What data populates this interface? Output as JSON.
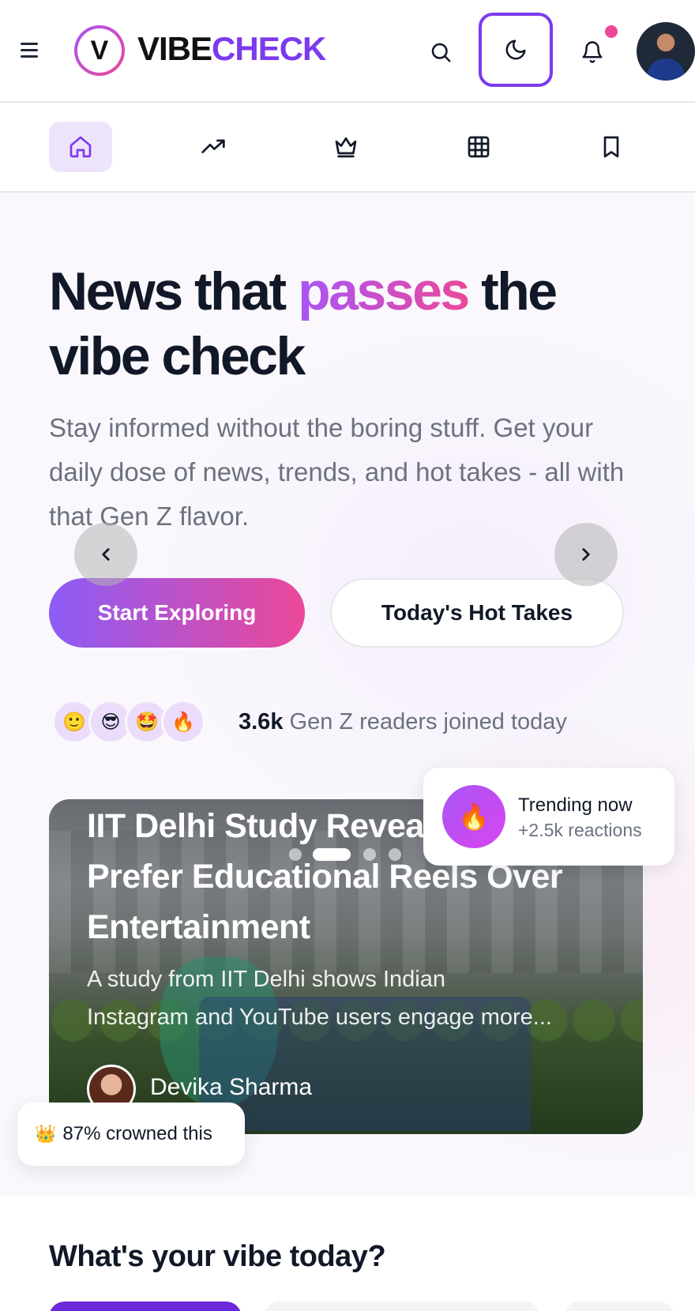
{
  "header": {
    "logo_letter": "V",
    "logo_text_a": "VIBE",
    "logo_text_b": "CHECK"
  },
  "nav": {
    "tabs": [
      {
        "name": "home",
        "icon": "home-icon",
        "active": true
      },
      {
        "name": "trending",
        "icon": "trending-icon",
        "active": false
      },
      {
        "name": "crowned",
        "icon": "crown-icon",
        "active": false
      },
      {
        "name": "categories",
        "icon": "grid-icon",
        "active": false
      },
      {
        "name": "saved",
        "icon": "bookmark-icon",
        "active": false
      }
    ]
  },
  "hero": {
    "title_part1": "News that ",
    "title_highlight": "passes",
    "title_part2": " the vibe check",
    "subtitle": "Stay informed without the boring stuff. Get your daily dose of news, trends, and hot takes - all with that Gen Z flavor.",
    "primary_button": "Start Exploring",
    "secondary_button": "Today's Hot Takes",
    "reader_emojis": [
      "🙂",
      "😎",
      "🤩",
      "🔥"
    ],
    "reader_count": "3.6k",
    "reader_text": " Gen Z readers joined today"
  },
  "carousel": {
    "title": "IIT Delhi Study Reveals Users Prefer Educational Reels Over Entertainment",
    "description_line1": "A study from IIT Delhi shows Indian",
    "description_line2": "Instagram and YouTube users engage more...",
    "author": "Devika Sharma",
    "slide_count": 4,
    "active_slide": 2
  },
  "trending_card": {
    "emoji": "🔥",
    "title": "Trending now",
    "subtitle": "+2.5k reactions"
  },
  "crown_card": {
    "emoji": "👑",
    "text": "87% crowned this"
  },
  "vibe_section": {
    "title": "What's your vibe today?"
  },
  "colors": {
    "brand_purple": "#7c3aed",
    "gradient_start": "#a855f7",
    "gradient_end": "#ec4899",
    "active_tab_bg": "#ede4fc"
  }
}
